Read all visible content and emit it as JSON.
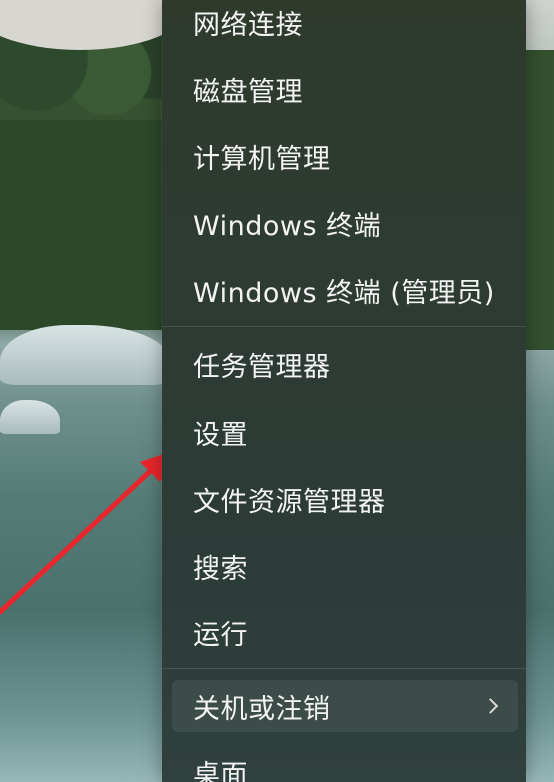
{
  "context_menu": {
    "items": [
      {
        "label": "网络连接"
      },
      {
        "label": "磁盘管理"
      },
      {
        "label": "计算机管理"
      },
      {
        "label": "Windows 终端"
      },
      {
        "label": "Windows 终端 (管理员)"
      },
      {
        "label": "任务管理器"
      },
      {
        "label": "设置"
      },
      {
        "label": "文件资源管理器"
      },
      {
        "label": "搜索"
      },
      {
        "label": "运行"
      },
      {
        "label": "关机或注销",
        "submenu_icon": "chevron-right-icon"
      },
      {
        "label": "桌面"
      }
    ]
  },
  "annotation": {
    "arrow_color": "#e8262b",
    "target": "设置"
  },
  "colors": {
    "menu_background": "#2e3b33",
    "menu_text": "#f3f3f3"
  }
}
